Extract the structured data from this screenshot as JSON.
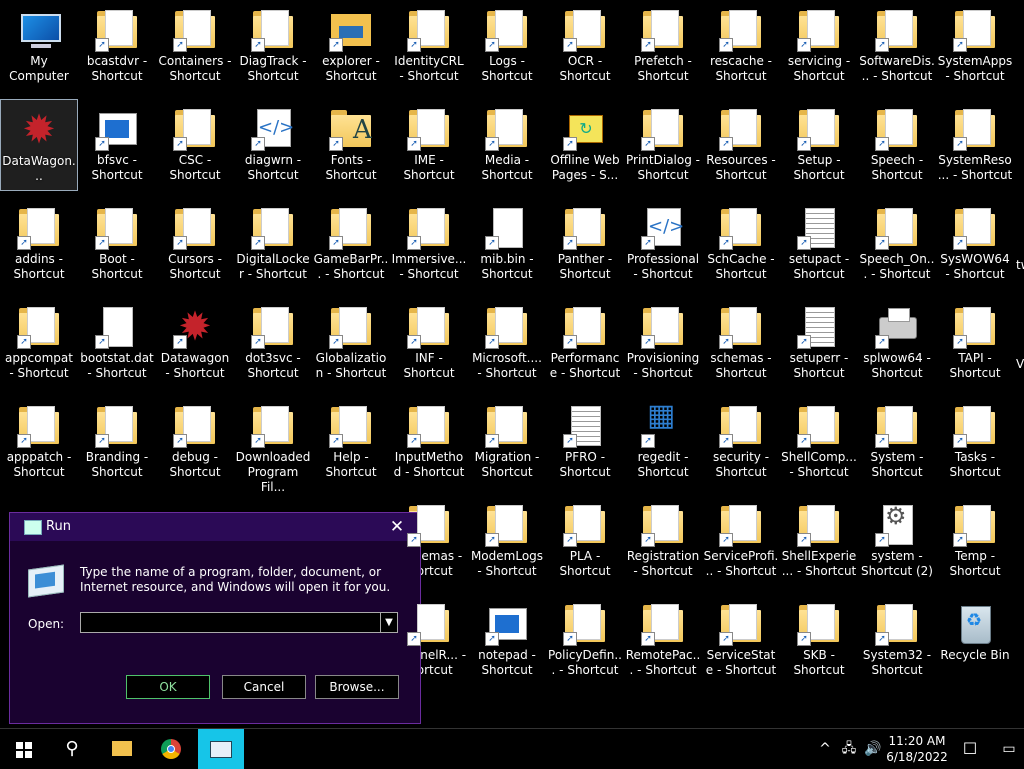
{
  "desktop": {
    "columns": [
      [
        "My Computer",
        "DataWagon...",
        "addins - Shortcut",
        "appcompat - Shortcut",
        "apppatch - Shortcut",
        "",
        ""
      ],
      [
        "bcastdvr - Shortcut",
        "bfsvc - Shortcut",
        "Boot - Shortcut",
        "bootstat.dat - Shortcut",
        "Branding - Shortcut",
        "",
        ""
      ],
      [
        "Containers - Shortcut",
        "CSC - Shortcut",
        "Cursors - Shortcut",
        "Datawagon - Shortcut",
        "debug - Shortcut",
        "",
        ""
      ],
      [
        "DiagTrack - Shortcut",
        "diagwrn - Shortcut",
        "DigitalLocker - Shortcut",
        "dot3svc - Shortcut",
        "Downloaded Program Fil...",
        "",
        ""
      ],
      [
        "explorer - Shortcut",
        "Fonts - Shortcut",
        "GameBarPr... - Shortcut",
        "Globalization - Shortcut",
        "Help - Shortcut",
        "",
        ""
      ],
      [
        "IdentityCRL - Shortcut",
        "IME - Shortcut",
        "Immersive... - Shortcut",
        "INF - Shortcut",
        "InputMethod - Shortcut",
        "...chemas - ...ortcut",
        "...ternelR... - ...ortcut"
      ],
      [
        "Logs - Shortcut",
        "Media - Shortcut",
        "mib.bin - Shortcut",
        "Microsoft.... - Shortcut",
        "Migration - Shortcut",
        "ModemLogs - Shortcut",
        "notepad - Shortcut"
      ],
      [
        "OCR - Shortcut",
        "Offline Web Pages - S...",
        "Panther - Shortcut",
        "Performance - Shortcut",
        "PFRO - Shortcut",
        "PLA - Shortcut",
        "PolicyDefin... - Shortcut"
      ],
      [
        "Prefetch - Shortcut",
        "PrintDialog - Shortcut",
        "Professional - Shortcut",
        "Provisioning - Shortcut",
        "regedit - Shortcut",
        "Registration - Shortcut",
        "RemotePac... - Shortcut"
      ],
      [
        "rescache - Shortcut",
        "Resources - Shortcut",
        "SchCache - Shortcut",
        "schemas - Shortcut",
        "security - Shortcut",
        "ServiceProfi... - Shortcut",
        "ServiceState - Shortcut"
      ],
      [
        "servicing - Shortcut",
        "Setup - Shortcut",
        "setupact - Shortcut",
        "setuperr - Shortcut",
        "ShellComp... - Shortcut",
        "ShellExperie... - Shortcut",
        "SKB - Shortcut"
      ],
      [
        "SoftwareDis... - Shortcut",
        "Speech - Shortcut",
        "Speech_On... - Shortcut",
        "splwow64 - Shortcut",
        "System - Shortcut",
        "system - Shortcut (2)",
        "System32 - Shortcut"
      ],
      [
        "SystemApps - Shortcut",
        "SystemReso... - Shortcut",
        "SysWOW64 - Shortcut",
        "TAPI - Shortcut",
        "Tasks - Shortcut",
        "Temp - Shortcut",
        "Recycle Bin"
      ]
    ],
    "edge_fragments": [
      "tw",
      "V"
    ]
  },
  "run_dialog": {
    "title": "Run",
    "close_glyph": "✕",
    "description": "Type the name of a program, folder, document, or Internet resource, and Windows will open it for you.",
    "open_label": "Open:",
    "open_value": "",
    "ok_label": "OK",
    "cancel_label": "Cancel",
    "browse_label": "Browse..."
  },
  "taskbar": {
    "search_glyph": "⚲",
    "tray_chevron": "^",
    "clock_time": "11:20 AM",
    "clock_date": "6/18/2022",
    "notification_glyph": "☐"
  },
  "colors": {
    "dialog_titlebar": "#2b0a56",
    "dialog_body": "#1a0230",
    "ok_border": "#4fc26a",
    "taskbar_active": "#16c5e8"
  }
}
